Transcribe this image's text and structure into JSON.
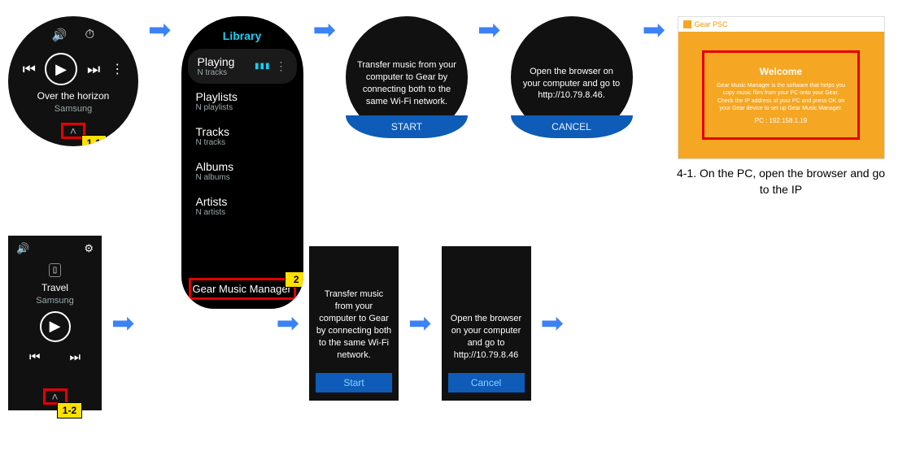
{
  "labels": {
    "l1_1": "1-1",
    "l1_2": "1-2",
    "l2": "2"
  },
  "round_player": {
    "title": "Over the horizon",
    "artist": "Samsung"
  },
  "rect_player": {
    "title": "Travel",
    "artist": "Samsung"
  },
  "library": {
    "title": "Library",
    "playing": {
      "label": "Playing",
      "sub": "N tracks"
    },
    "items": [
      {
        "label": "Playlists",
        "sub": "N playlists"
      },
      {
        "label": "Tracks",
        "sub": "N tracks"
      },
      {
        "label": "Albums",
        "sub": "N albums"
      },
      {
        "label": "Artists",
        "sub": "N artists"
      }
    ],
    "gmm": "Gear Music Manager"
  },
  "round_transfer": {
    "msg": "Transfer music from your computer to Gear by connecting both to the same Wi-Fi network.",
    "btn": "START"
  },
  "round_open": {
    "msg": "Open the browser on your computer and go to http://10.79.8.46.",
    "btn": "CANCEL"
  },
  "rect_transfer": {
    "msg": "Transfer music from your computer to Gear by connecting both to the same Wi-Fi network.",
    "btn": "Start"
  },
  "rect_open": {
    "msg": "Open the browser on your computer and go to http://10.79.8.46",
    "btn": "Cancel"
  },
  "pc": {
    "tab": "Gear PSC",
    "welcome_title": "Welcome",
    "welcome_msg": "Gear Music Manager is the software that helps you copy music files from your PC onto your Gear. Check the IP address of your PC and press OK on your Gear device to set up Gear Music Manager.",
    "welcome_ip": "PC : 192.158.1.19",
    "caption": "4-1. On the PC, open the browser and go to the IP"
  }
}
